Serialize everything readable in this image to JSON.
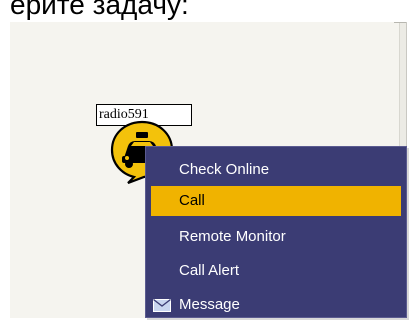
{
  "caption": {
    "text": "ерите задачу:"
  },
  "map": {
    "vehicle_label": "radio591",
    "icons": {
      "vehicle_marker": "taxi-car-icon"
    }
  },
  "context_menu": {
    "items": [
      {
        "label": "Check Online",
        "highlighted": false
      },
      {
        "label": "Call",
        "highlighted": true
      },
      {
        "label": "Remote Monitor",
        "highlighted": false
      },
      {
        "label": "Call Alert",
        "highlighted": false
      },
      {
        "label": "Message",
        "highlighted": false,
        "icon": "envelope-icon"
      }
    ]
  },
  "colors": {
    "menu_background": "#3b3c74",
    "menu_highlight": "#f0b300",
    "marker_yellow": "#f3c20b",
    "map_background": "#f5f4ef"
  }
}
